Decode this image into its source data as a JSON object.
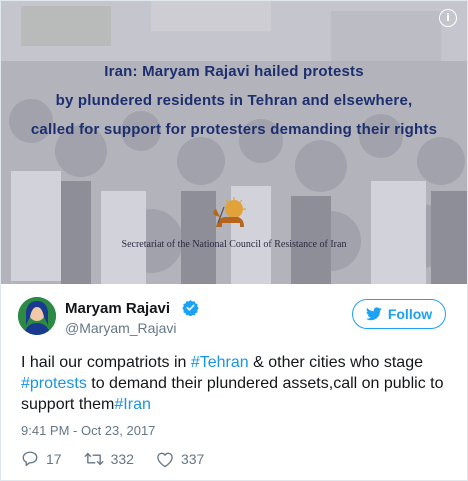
{
  "media": {
    "headline_lines": [
      "Iran: Maryam Rajavi hailed protests",
      "by plundered residents in Tehran and elsewhere,",
      "called for support for protesters demanding their rights"
    ],
    "secretariat": "Secretariat of the National Council of Resistance of Iran",
    "info_glyph": "i"
  },
  "author": {
    "display_name": "Maryam Rajavi",
    "handle": "@Maryam_Rajavi",
    "verified": true
  },
  "follow_button": {
    "label": "Follow"
  },
  "tweet": {
    "segments": [
      {
        "text": "I hail our compatriots in ",
        "type": "text"
      },
      {
        "text": "#Tehran",
        "type": "hashtag"
      },
      {
        "text": " & other cities who stage ",
        "type": "text"
      },
      {
        "text": "#protests",
        "type": "hashtag"
      },
      {
        "text": " to demand their plundered assets,call on public to support them",
        "type": "text"
      },
      {
        "text": "#Iran",
        "type": "hashtag"
      }
    ],
    "timestamp": "9:41 PM - Oct 23, 2017"
  },
  "actions": {
    "replies": "17",
    "retweets": "332",
    "likes": "337"
  },
  "icons": {
    "info": "info-icon",
    "verified": "verified-badge-icon",
    "follow": "twitter-bird-icon",
    "reply": "reply-icon",
    "retweet": "retweet-icon",
    "like": "heart-icon"
  },
  "colors": {
    "accent": "#1da1f2",
    "hashtag": "#1b95e0",
    "muted": "#657786",
    "headline": "#1d2f6e"
  }
}
